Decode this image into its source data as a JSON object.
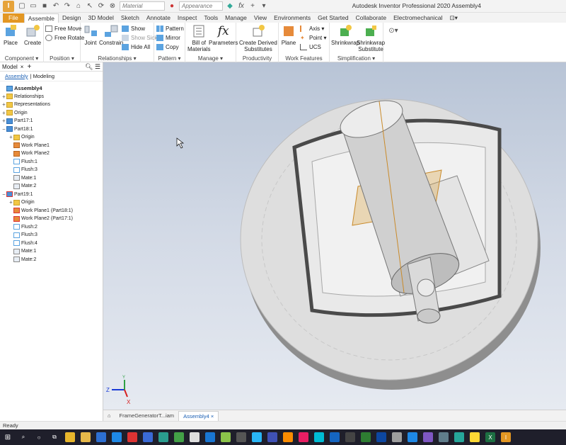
{
  "window": {
    "title": "Autodesk Inventor Professional 2020   Assembly4",
    "quick_access": {
      "material_placeholder": "Material",
      "appearance_placeholder": "Appearance"
    }
  },
  "ribbon_tabs": [
    "File",
    "Assemble",
    "Design",
    "3D Model",
    "Sketch",
    "Annotate",
    "Inspect",
    "Tools",
    "Manage",
    "View",
    "Environments",
    "Get Started",
    "Collaborate",
    "Electromechanical"
  ],
  "active_tab": "Assemble",
  "ribbon": {
    "component": {
      "label": "Component ▾",
      "place": "Place",
      "create": "Create"
    },
    "position": {
      "label": "Position ▾",
      "free_move": "Free Move",
      "free_rotate": "Free Rotate"
    },
    "relationships": {
      "label": "Relationships ▾",
      "joint": "Joint",
      "constrain": "Constrain",
      "show": "Show",
      "show_sick": "Show Sick",
      "hide_all": "Hide All"
    },
    "pattern": {
      "label": "Pattern ▾",
      "pattern": "Pattern",
      "mirror": "Mirror",
      "copy": "Copy"
    },
    "manage": {
      "label": "Manage ▾",
      "bom_line1": "Bill of",
      "bom_line2": "Materials",
      "parameters": "Parameters"
    },
    "productivity": {
      "label": "Productivity",
      "create_derived_1": "Create Derived",
      "create_derived_2": "Substitutes"
    },
    "work_features": {
      "label": "Work Features",
      "plane": "Plane",
      "axis": "Axis ▾",
      "point": "Point ▾",
      "ucs": "UCS"
    },
    "simplification": {
      "label": "Simplification ▾",
      "shrinkwrap": "Shrinkwrap",
      "shrinkwrap_sub_1": "Shrinkwrap",
      "shrinkwrap_sub_2": "Substitute"
    }
  },
  "browser": {
    "title": "Model",
    "close": "×",
    "add": "+",
    "tabs": [
      "Assembly",
      "Modeling"
    ],
    "tree": [
      {
        "label": "Assembly4",
        "depth": 0,
        "toggle": "",
        "icon": "assembly",
        "bold": true
      },
      {
        "label": "Relationships",
        "depth": 0,
        "toggle": "+",
        "icon": "folder"
      },
      {
        "label": "Representations",
        "depth": 0,
        "toggle": "+",
        "icon": "folder"
      },
      {
        "label": "Origin",
        "depth": 0,
        "toggle": "+",
        "icon": "folder"
      },
      {
        "label": "Part17:1",
        "depth": 0,
        "toggle": "+",
        "icon": "part"
      },
      {
        "label": "Part18:1",
        "depth": 0,
        "toggle": "−",
        "icon": "part"
      },
      {
        "label": "Origin",
        "depth": 1,
        "toggle": "+",
        "icon": "folder"
      },
      {
        "label": "Work Plane1",
        "depth": 1,
        "toggle": "",
        "icon": "plane"
      },
      {
        "label": "Work Plane2",
        "depth": 1,
        "toggle": "",
        "icon": "plane"
      },
      {
        "label": "Flush:1",
        "depth": 1,
        "toggle": "",
        "icon": "constraint"
      },
      {
        "label": "Flush:3",
        "depth": 1,
        "toggle": "",
        "icon": "constraint"
      },
      {
        "label": "Mate:1",
        "depth": 1,
        "toggle": "",
        "icon": "mate"
      },
      {
        "label": "Mate:2",
        "depth": 1,
        "toggle": "",
        "icon": "mate"
      },
      {
        "label": "Part19:1",
        "depth": 0,
        "toggle": "−",
        "icon": "part-link"
      },
      {
        "label": "Origin",
        "depth": 1,
        "toggle": "+",
        "icon": "folder"
      },
      {
        "label": "Work Plane1 (Part18:1)",
        "depth": 1,
        "toggle": "",
        "icon": "plane-link"
      },
      {
        "label": "Work Plane2 (Part17:1)",
        "depth": 1,
        "toggle": "",
        "icon": "plane-link"
      },
      {
        "label": "Flush:2",
        "depth": 1,
        "toggle": "",
        "icon": "constraint"
      },
      {
        "label": "Flush:3",
        "depth": 1,
        "toggle": "",
        "icon": "constraint"
      },
      {
        "label": "Flush:4",
        "depth": 1,
        "toggle": "",
        "icon": "constraint"
      },
      {
        "label": "Mate:1",
        "depth": 1,
        "toggle": "",
        "icon": "mate"
      },
      {
        "label": "Mate:2",
        "depth": 1,
        "toggle": "",
        "icon": "mate"
      }
    ]
  },
  "viewport": {
    "triad": {
      "z": "Z",
      "x": "X",
      "y": "Y"
    }
  },
  "document_tabs": [
    {
      "label": "FrameGeneratorT...iam",
      "active": false
    },
    {
      "label": "Assembly4",
      "active": true
    }
  ],
  "status": "Ready",
  "colors": {
    "file_tab": "#e39723",
    "accent_blue": "#1a5fb4",
    "work_plane": "#d9a441",
    "taskbar": "#1f1f2b"
  }
}
